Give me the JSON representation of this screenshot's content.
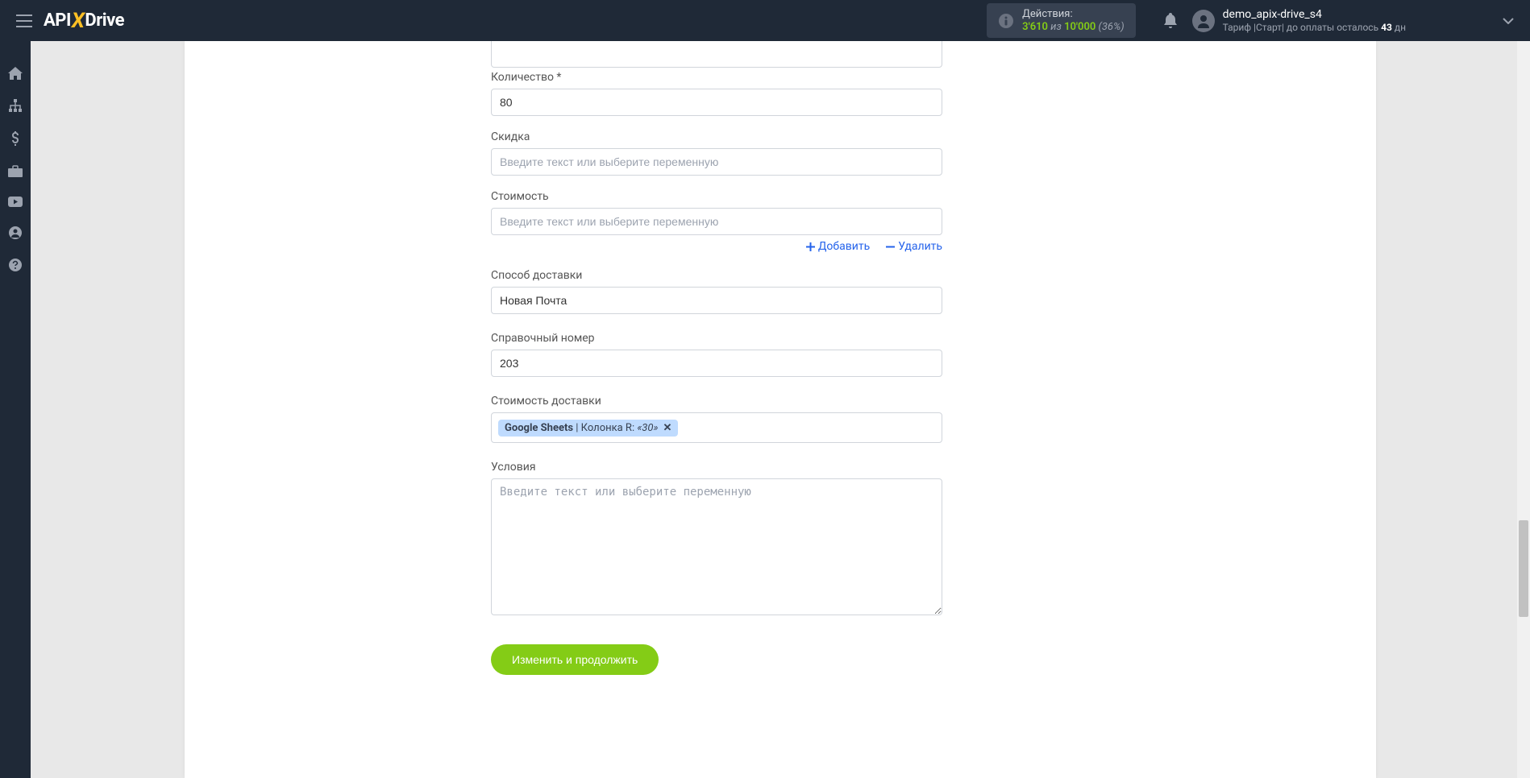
{
  "header": {
    "logo_api": "API",
    "logo_x": "X",
    "logo_drive": "Drive",
    "actions_label": "Действия:",
    "actions_used": "3'610",
    "actions_of": " из ",
    "actions_total": "10'000",
    "actions_pct": " (36%)",
    "user_name": "demo_apix-drive_s4",
    "user_plan_prefix": "Тариф |Старт| до оплаты осталось ",
    "user_plan_days": "43",
    "user_plan_suffix": " дн"
  },
  "form": {
    "quantity_label": "Количество *",
    "quantity_value": "80",
    "discount_label": "Скидка",
    "discount_placeholder": "Введите текст или выберите переменную",
    "cost_label": "Стоимость",
    "cost_placeholder": "Введите текст или выберите переменную",
    "add_label": "Добавить",
    "delete_label": "Удалить",
    "delivery_method_label": "Способ доставки",
    "delivery_method_value": "Новая Почта",
    "reference_label": "Справочный номер",
    "reference_value": "203",
    "delivery_cost_label": "Стоимость доставки",
    "tag_source": "Google Sheets",
    "tag_sep": " | Колонка R: ",
    "tag_value": "«30»",
    "conditions_label": "Условия",
    "conditions_placeholder": "Введите текст или выберите переменную",
    "submit_label": "Изменить и продолжить"
  }
}
